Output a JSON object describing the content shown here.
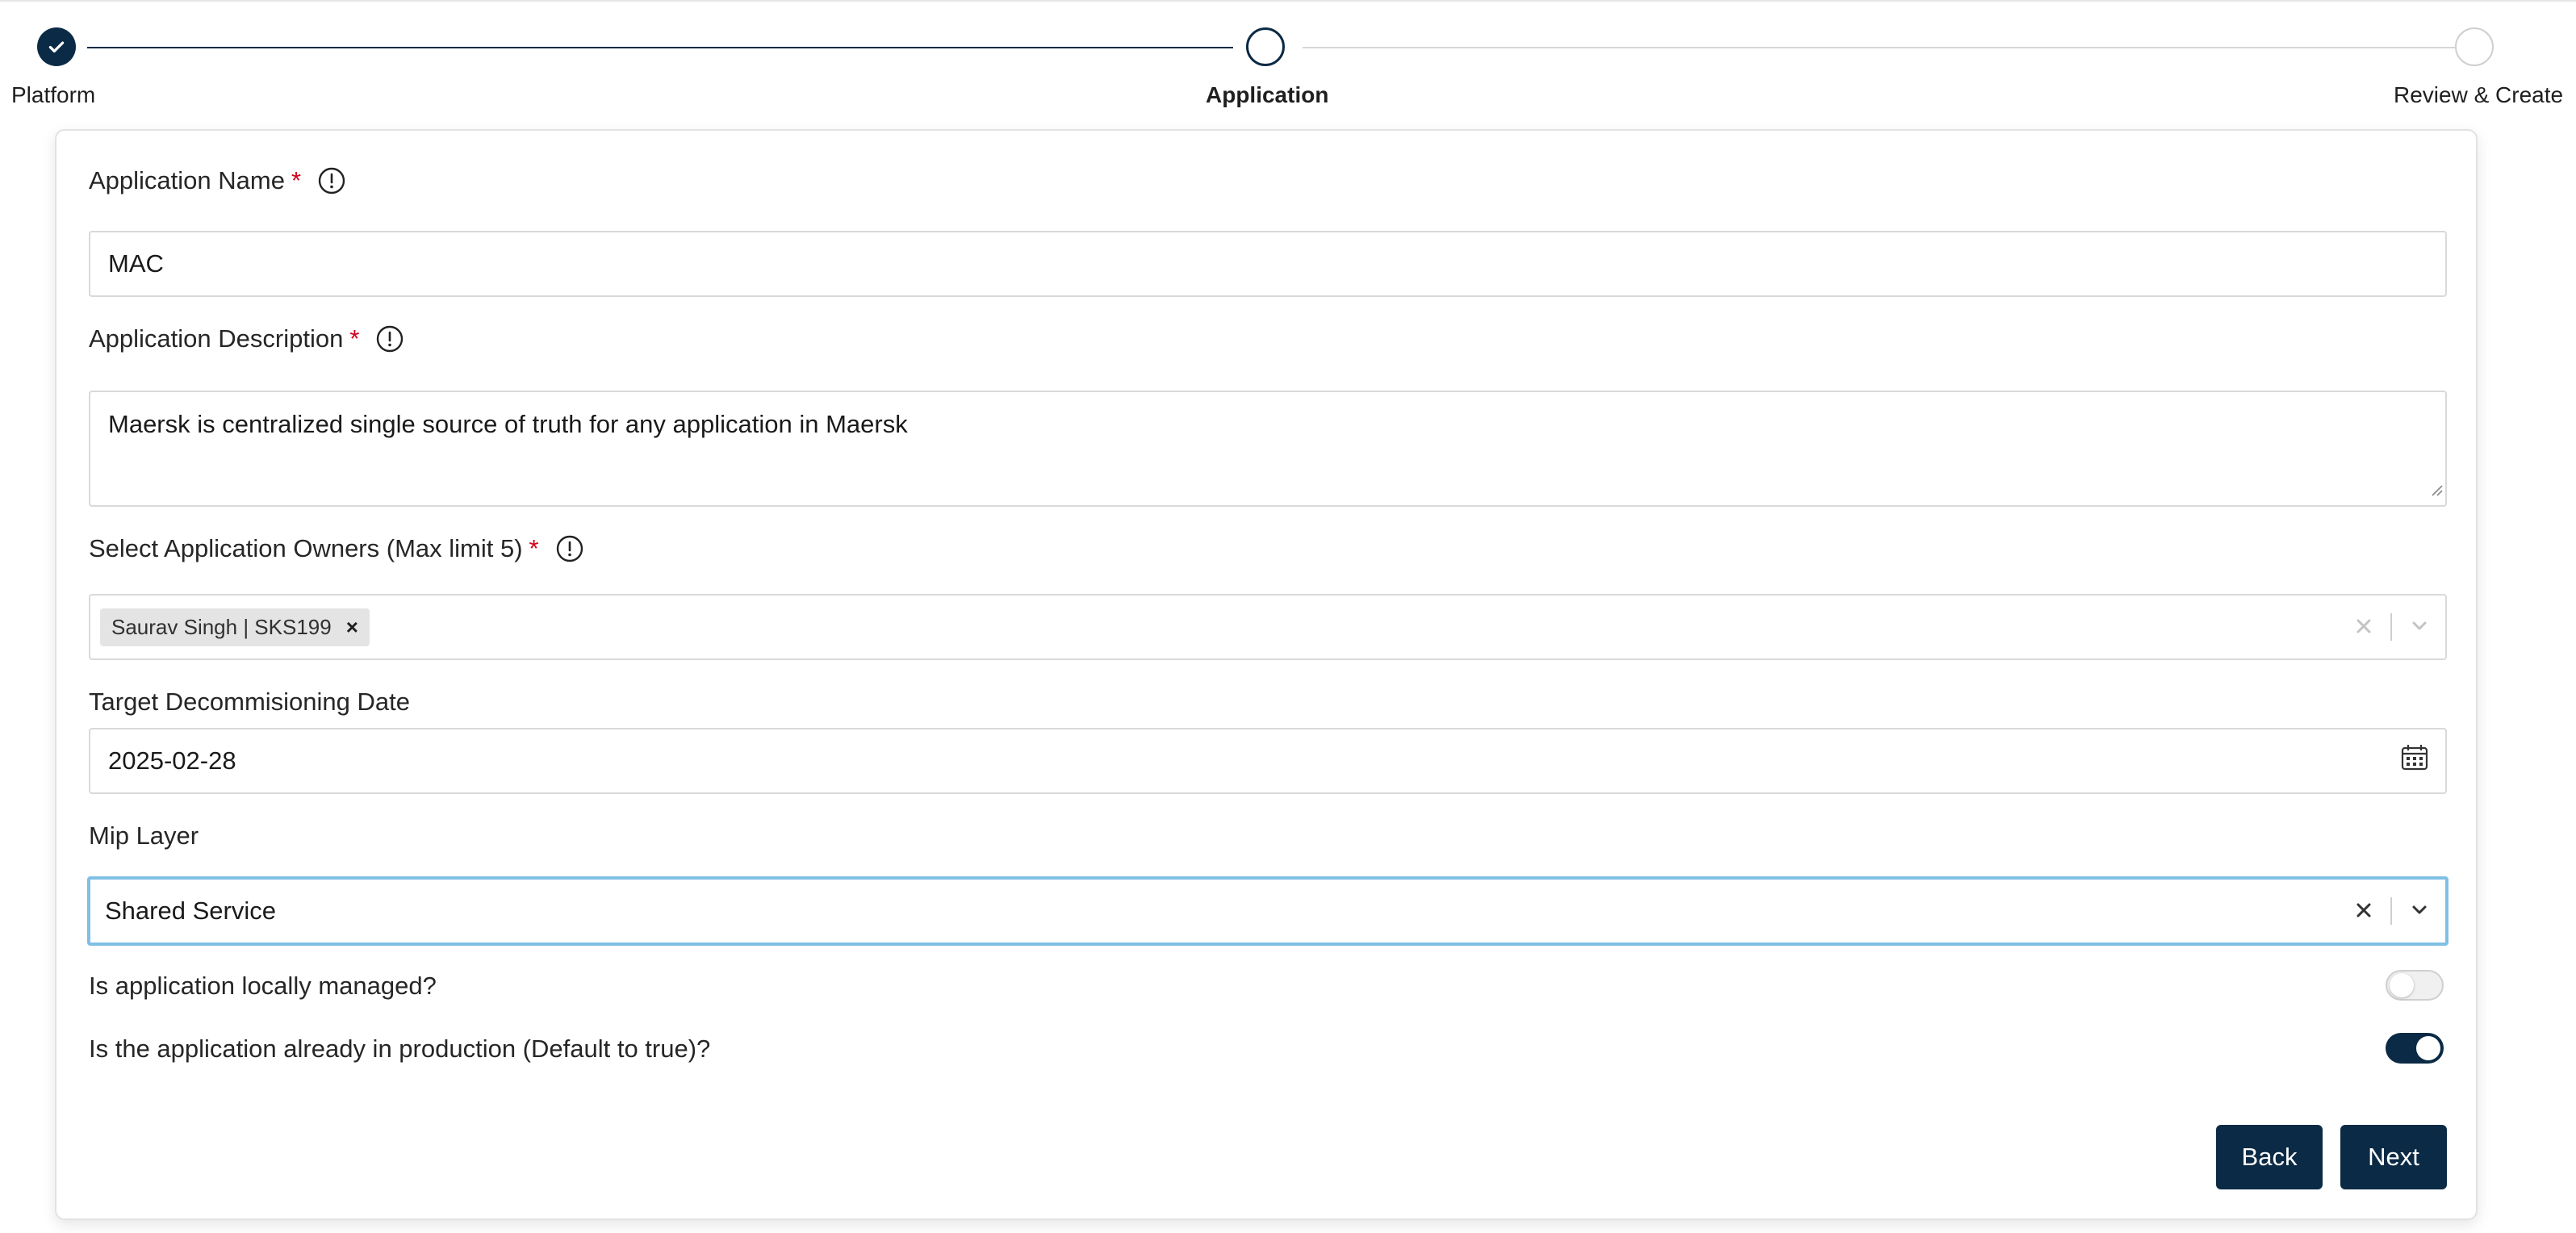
{
  "stepper": {
    "steps": [
      {
        "label": "Platform",
        "state": "completed"
      },
      {
        "label": "Application",
        "state": "current"
      },
      {
        "label": "Review & Create",
        "state": "pending"
      }
    ]
  },
  "form": {
    "application_name": {
      "label": "Application Name",
      "required_mark": "*",
      "value": "MAC"
    },
    "application_description": {
      "label": "Application Description",
      "required_mark": "*",
      "value": "Maersk is centralized single source of truth for any application in Maersk"
    },
    "application_owners": {
      "label": "Select Application Owners (Max limit 5)",
      "required_mark": "*",
      "selected": [
        "Saurav Singh | SKS199"
      ],
      "chip_remove": "×"
    },
    "decommissioning_date": {
      "label": "Target Decommisioning Date",
      "value": "2025-02-28"
    },
    "mip_layer": {
      "label": "Mip Layer",
      "value": "Shared Service"
    },
    "locally_managed": {
      "label": "Is application locally managed?",
      "checked": false
    },
    "in_production": {
      "label": "Is the application already in production (Default to true)?",
      "checked": true
    }
  },
  "buttons": {
    "back": "Back",
    "next": "Next"
  },
  "colors": {
    "primary": "#0b2a45",
    "required": "#d0021b",
    "focus": "#7fc0e4"
  }
}
